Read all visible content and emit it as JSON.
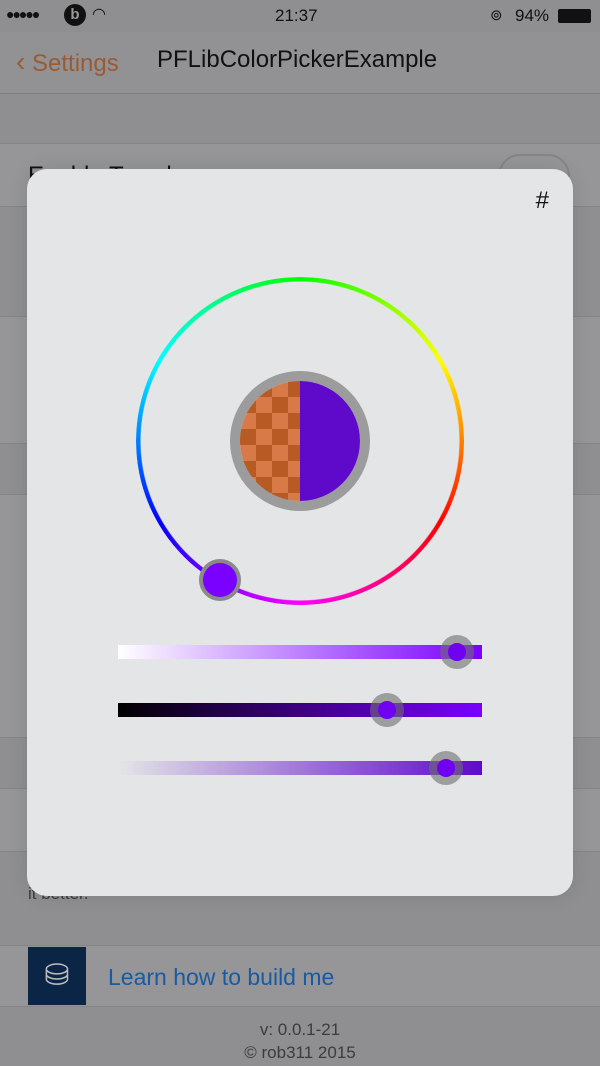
{
  "status_bar": {
    "time": "21:37",
    "battery": "94%",
    "signal_icon": "signal-dots-icon",
    "carrier_icon": "beats-icon",
    "wifi_icon": "wifi-icon",
    "lock_icon": "rotation-lock-icon"
  },
  "nav": {
    "back_label": "Settings",
    "title": "PFLibColorPickerExample"
  },
  "background": {
    "row_label": "Enable Tweak",
    "footer_text": "it better.",
    "link_label": "Learn how to build me",
    "version": "v: 0.0.1-21",
    "copyright": "© rob311 2015"
  },
  "picker": {
    "hex_label": "#",
    "hue_degrees": 270,
    "saturation": 0.93,
    "brightness": 0.74,
    "alpha": 0.9,
    "selected_color": "#7a00ff",
    "original_color": "#d87a48",
    "accent": "#9a5a34",
    "link_color": "#1a5aa0"
  }
}
